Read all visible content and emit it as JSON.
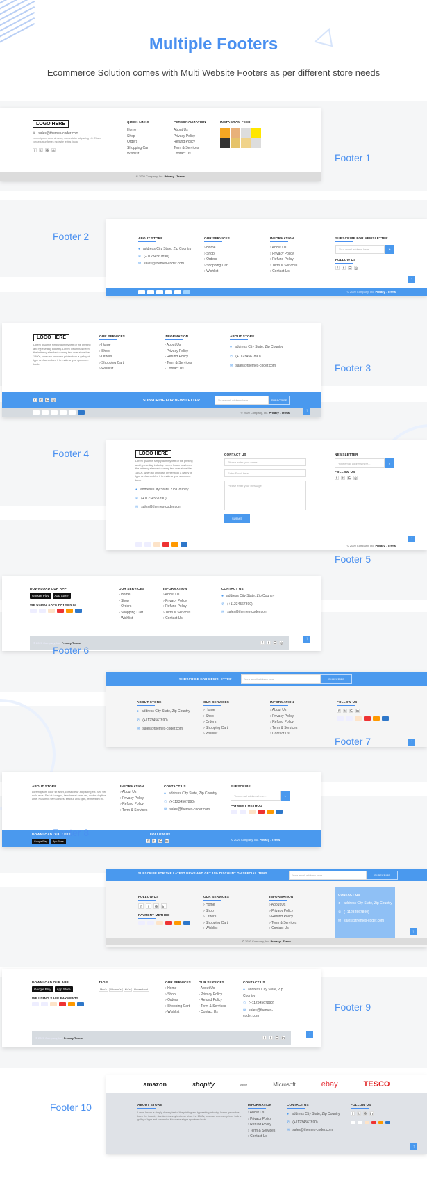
{
  "header": {
    "title": "Multiple Footers",
    "subtitle": "Ecommerce Solution comes with Multi Website Footers as per different store needs"
  },
  "labels": [
    "Footer 1",
    "Footer 2",
    "Footer 3",
    "Footer 4",
    "Footer 5",
    "Footer 6",
    "Footer 7",
    "Footer 8",
    "Footer 9",
    "Footer 10"
  ],
  "common": {
    "logo": "LOGO HERE",
    "address": "address City State, Zip Country",
    "phone": "(+11234567890)",
    "email": "sales@themes-coder.com",
    "copyright": "© 2020 Company, Inc.",
    "privacy": "Privacy",
    "terms": "Terms",
    "lorem": "Lorem Ipsum is simply dummy text of the printing and typesetting industry. Lorem Ipsum has been the industry standard dummy text ever since the 1500s, when an unknown printer took a galley of type and scrambled it to make a type specimen book.",
    "email_placeholder": "Your email address here...",
    "subscribe": "SUBSCRIBE",
    "services": [
      "Home",
      "Shop",
      "Orders",
      "Shopping Cart",
      "Wishlist"
    ],
    "information": [
      "About Us",
      "Privacy Policy",
      "Refund Policy",
      "Term & Services",
      "Contact Us"
    ],
    "h_about": "ABOUT STORE",
    "h_services": "OUR SERVICES",
    "h_info": "INFORMATION",
    "h_contact": "CONTACT US",
    "h_follow": "FOLLOW US",
    "h_newsletter": "SUBSCRIBE FOR NEWSLETTER",
    "h_payment": "PAYMENT METHOD",
    "h_app": "DOWNLOAD OUR APP",
    "h_safe": "WE USING SAFE PAYMENTS",
    "google_play": "Google Play",
    "app_store": "App Store",
    "payments": [
      "VISA",
      "PayPal",
      "Discover",
      "Maestro",
      "MasterCard",
      "Amex"
    ]
  },
  "footer1": {
    "h_quick": "QUICK LINKS",
    "h_personal": "PERSONALIZATION",
    "h_insta": "INSTAGRAM FEED",
    "about_text": "Lorem ipsum dolor sit amet, consectetur adipiscing elit. Etiam consequatur fames molestie lectus ligula.",
    "quick": [
      "Home",
      "Shop",
      "Orders",
      "Shopping Cart",
      "Wishlist"
    ],
    "personal": [
      "About Us",
      "Privacy Policy",
      "Refund Policy",
      "Term & Services",
      "Contact Us"
    ]
  },
  "footer4": {
    "h_contact": "CONTACT US",
    "h_newsletter": "NEWSLETTER",
    "name_ph": "Please enter your name.",
    "email_ph": "Enter Email here..",
    "msg_ph": "Please enter your message.",
    "submit": "SUBMIT"
  },
  "footer7": {
    "about_text": "Lorem ipsum dolor sit amet, consectetur adipiscing elit. Sed vel nulla eros. Sed dui magna, faucibus et enim vel, auctor dapibus ante. Nullam in sem ultrices, efficitur arcu quis, fermentum mi.",
    "h_subscribe": "SUBSCRIBE",
    "h_apps": "DOWNLOAD OUR APPS",
    "info": [
      "About Us",
      "Privacy Policy",
      "Refund Policy",
      "Term & Services"
    ]
  },
  "footer8": {
    "banner": "SUBSCRIBE FOR THE LATEST NEWS AND GET 10% DISCOUNT ON SPECIAL ITEMS"
  },
  "footer9": {
    "h_tags": "TAGS",
    "tags": [
      "Men's",
      "Women's",
      "Kid's",
      "House Hold"
    ],
    "h_services2": "OUR SERVICES"
  },
  "footer10": {
    "brands": [
      "amazon",
      "shopify",
      "Apple",
      "Microsoft",
      "ebay",
      "TESCO"
    ]
  },
  "colors": {
    "accent": "#4a99ee",
    "title": "#4a90f0",
    "grey_bar": "#d6dbe0"
  }
}
